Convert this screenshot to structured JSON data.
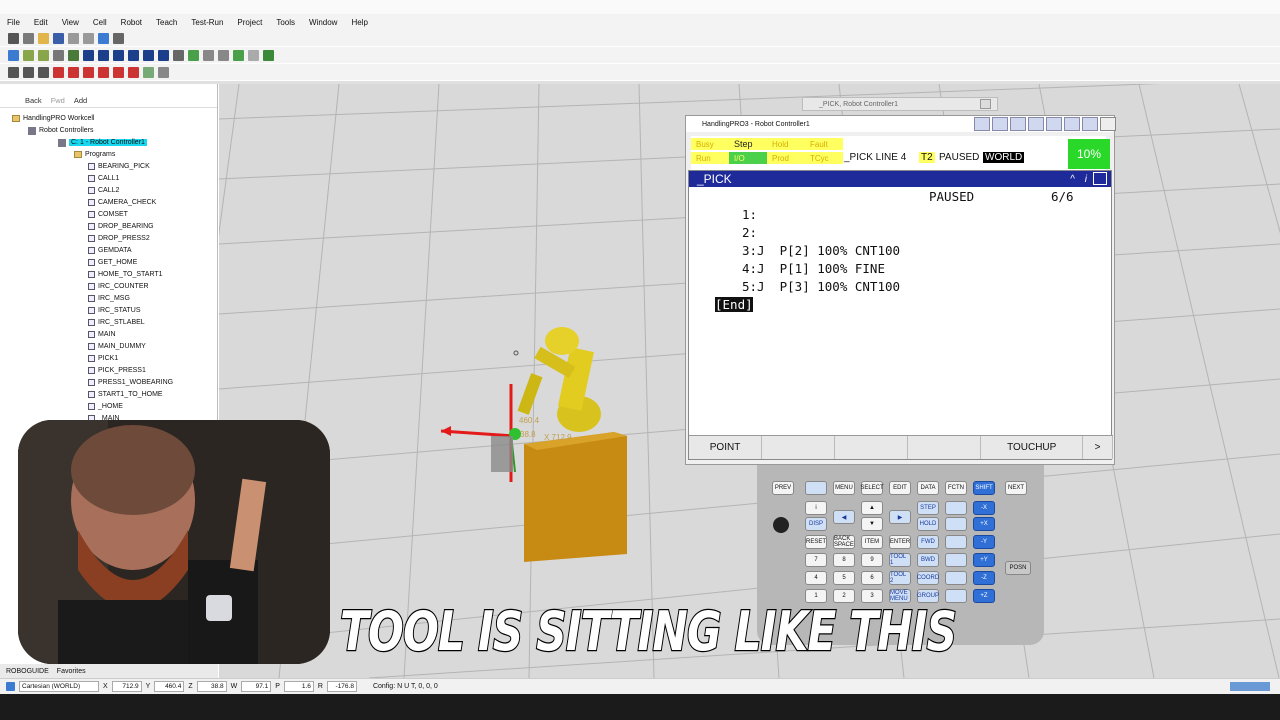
{
  "menu": [
    "File",
    "Edit",
    "View",
    "Cell",
    "Robot",
    "Teach",
    "Test-Run",
    "Project",
    "Tools",
    "Window",
    "Help"
  ],
  "nav": {
    "back": "Back",
    "fwd": "Fwd",
    "add": "Add"
  },
  "tree": {
    "workcell": "HandlingPRO Workcell",
    "controllers": "Robot Controllers",
    "controller": "C: 1 - Robot Controller1",
    "programs_label": "Programs",
    "programs": [
      "BEARING_PICK",
      "CALL1",
      "CALL2",
      "CAMERA_CHECK",
      "COMSET",
      "DROP_BEARING",
      "DROP_PRESS2",
      "GEMDATA",
      "GET_HOME",
      "HOME_TO_START1",
      "IRC_COUNTER",
      "IRC_MSG",
      "IRC_STATUS",
      "IRC_STLABEL",
      "MAIN",
      "MAIN_DUMMY",
      "PICK1",
      "PICK_PRESS1",
      "PRESS1_WOBEARING",
      "START1_TO_HOME",
      "_HOME",
      "_MAIN"
    ]
  },
  "bottom_tabs": [
    "ROBOGUIDE",
    "Favorites"
  ],
  "status": {
    "frame": "Cartesian (WORLD)",
    "x_label": "X",
    "x": "712.9",
    "y_label": "Y",
    "y": "460.4",
    "z_label": "Z",
    "z": "38.8",
    "w_label": "W",
    "w": "97.1",
    "p_label": "P",
    "p": "1.6",
    "r_label": "R",
    "r": "-176.8",
    "config": "Config: N U T, 0, 0, 0"
  },
  "viewport": {
    "tag1": "460.4",
    "tag2": "38.8",
    "tag3": "X 712.9"
  },
  "small_window": {
    "title": "_PICK, Robot Controller1"
  },
  "pendant": {
    "title": "HandlingPRO3 - Robot Controller1",
    "busy": "Busy",
    "step": "Step",
    "hold": "Hold",
    "fault": "Fault",
    "run": "Run",
    "io": "I/O",
    "prod": "Prod",
    "tcyc": "TCyc",
    "line": "_PICK LINE 4",
    "t2": "T2",
    "paused": "PAUSED",
    "world": "WORLD",
    "override": "10%",
    "program": "_PICK",
    "state": "PAUSED",
    "counter": "6/6",
    "lines": [
      "1:",
      "2:",
      "3:J  P[2] 100% CNT100",
      "4:J  P[1] 100% FINE",
      "5:J  P[3] 100% CNT100"
    ],
    "end": "[End]",
    "fkeys": [
      "POINT",
      "",
      "",
      "",
      "TOUCHUP",
      ">"
    ],
    "keys": {
      "prev": "PREV",
      "menu": "MENU",
      "select": "SELECT",
      "edit": "EDIT",
      "data": "DATA",
      "fctn": "FCTN",
      "shift": "SHIFT",
      "next": "NEXT",
      "step": "STEP",
      "hold": "HOLD",
      "reset": "RESET",
      "backspace": "BACK SPACE",
      "item": "ITEM",
      "enter": "ENTER",
      "fwd": "FWD",
      "bwd": "BWD",
      "tool1": "TOOL 1",
      "tool2": "TOOL 2",
      "coord": "COORD",
      "group": "GROUP",
      "movemenu": "MOVE MENU",
      "disp": "DISP",
      "posn": "POSN",
      "n7": "7",
      "n8": "8",
      "n9": "9",
      "n4": "4",
      "n5": "5",
      "n6": "6",
      "n1": "1",
      "n2": "2",
      "n3": "3"
    }
  },
  "caption": "TOOL IS SITTING LIKE THIS"
}
